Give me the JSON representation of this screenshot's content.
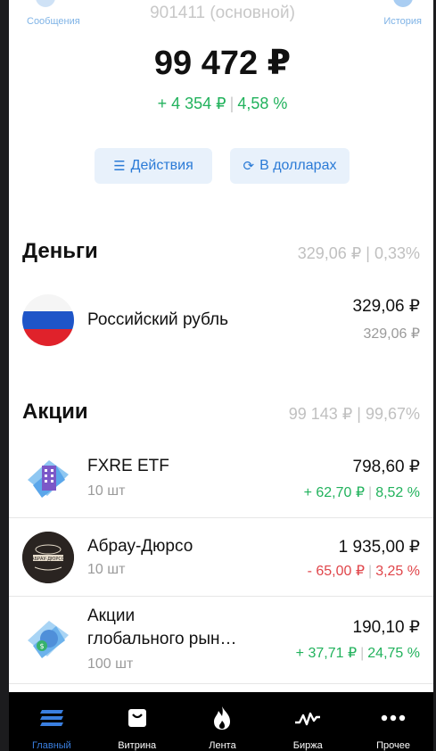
{
  "header": {
    "messages_label": "Сообщения",
    "history_label": "История",
    "account": "901411 (основной)",
    "total": "99 472 ₽",
    "change_abs": "+ 4 354 ₽",
    "change_pct": "4,58 %"
  },
  "buttons": {
    "actions": "Действия",
    "in_dollars": "В долларах"
  },
  "money": {
    "title": "Деньги",
    "summary": "329,06 ₽ | 0,33%",
    "items": [
      {
        "name": "Российский рубль",
        "value": "329,06 ₽",
        "sub": "329,06 ₽"
      }
    ]
  },
  "stocks": {
    "title": "Акции",
    "summary": "99 143 ₽ | 99,67%",
    "items": [
      {
        "name": "FXRE ETF",
        "qty": "10 шт",
        "price": "798,60 ₽",
        "change_abs": "+ 62,70 ₽",
        "change_pct": "8,52 %",
        "trend": "up"
      },
      {
        "name": "Абрау-Дюрсо",
        "qty": "10 шт",
        "price": "1 935,00 ₽",
        "change_abs": "- 65,00 ₽",
        "change_pct": "3,25 %",
        "trend": "down"
      },
      {
        "name_line1": "Акции",
        "name_line2": "глобального рын…",
        "qty": "100 шт",
        "price": "190,10 ₽",
        "change_abs": "+ 37,71 ₽",
        "change_pct": "24,75 %",
        "trend": "up"
      }
    ]
  },
  "nav": {
    "items": [
      {
        "label": "Главный",
        "icon": "home-bars-icon",
        "active": true
      },
      {
        "label": "Витрина",
        "icon": "bag-icon",
        "active": false
      },
      {
        "label": "Лента",
        "icon": "flame-icon",
        "active": false
      },
      {
        "label": "Биржа",
        "icon": "pulse-icon",
        "active": false
      },
      {
        "label": "Прочее",
        "icon": "more-dots-icon",
        "active": false
      }
    ]
  },
  "colors": {
    "accent": "#2a7ad6",
    "positive": "#21b25c",
    "negative": "#e0454a",
    "nav_active": "#3a7fe0"
  }
}
